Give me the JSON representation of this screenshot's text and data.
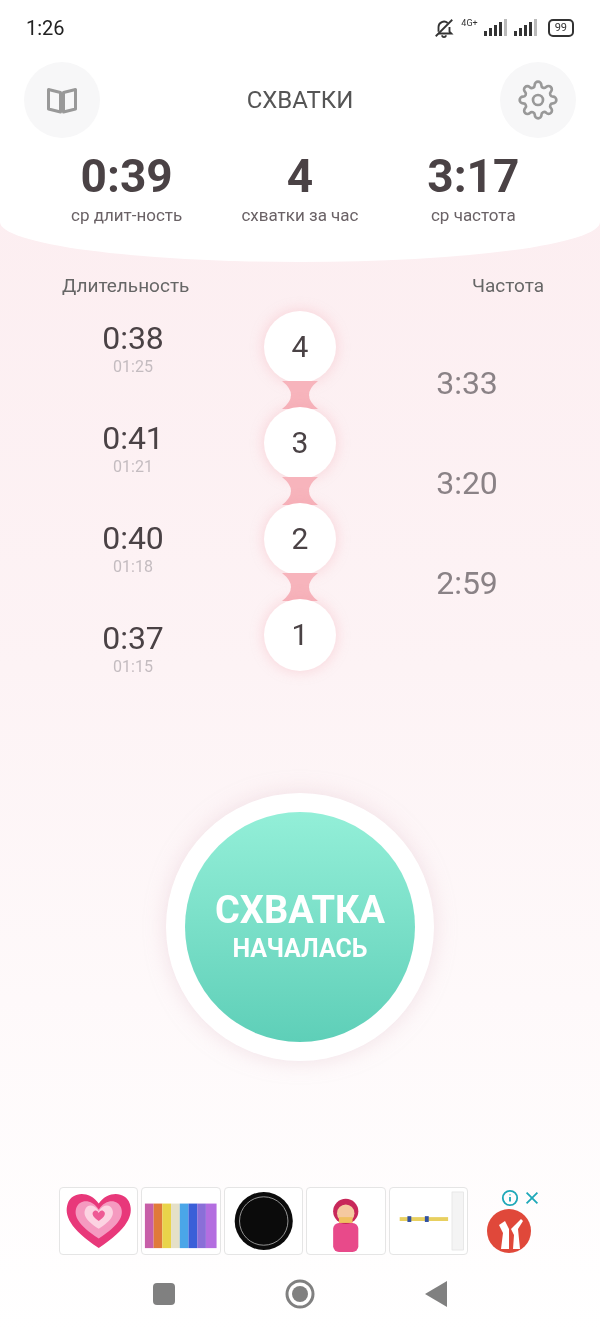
{
  "status_bar": {
    "time": "1:26",
    "network": "4G+",
    "battery": "99"
  },
  "header": {
    "title": "СХВАТКИ"
  },
  "stats": [
    {
      "value": "0:39",
      "label": "ср длит-ность"
    },
    {
      "value": "4",
      "label": "схватки за час"
    },
    {
      "value": "3:17",
      "label": "ср частота"
    }
  ],
  "columns": {
    "duration": "Длительность",
    "frequency": "Частота"
  },
  "contractions": [
    {
      "number": "4",
      "duration": "0:38",
      "time": "01:25"
    },
    {
      "number": "3",
      "duration": "0:41",
      "time": "01:21"
    },
    {
      "number": "2",
      "duration": "0:40",
      "time": "01:18"
    },
    {
      "number": "1",
      "duration": "0:37",
      "time": "01:15"
    }
  ],
  "frequencies": [
    "3:33",
    "3:20",
    "2:59"
  ],
  "main_button": {
    "line_1": "СХВАТКА",
    "line_2": "НАЧАЛАСЬ"
  },
  "ad": {
    "items": [
      {
        "kind": "picture"
      },
      {
        "kind": "picture"
      },
      {
        "kind": "picture"
      },
      {
        "kind": "picture"
      },
      {
        "kind": "picture"
      }
    ]
  }
}
